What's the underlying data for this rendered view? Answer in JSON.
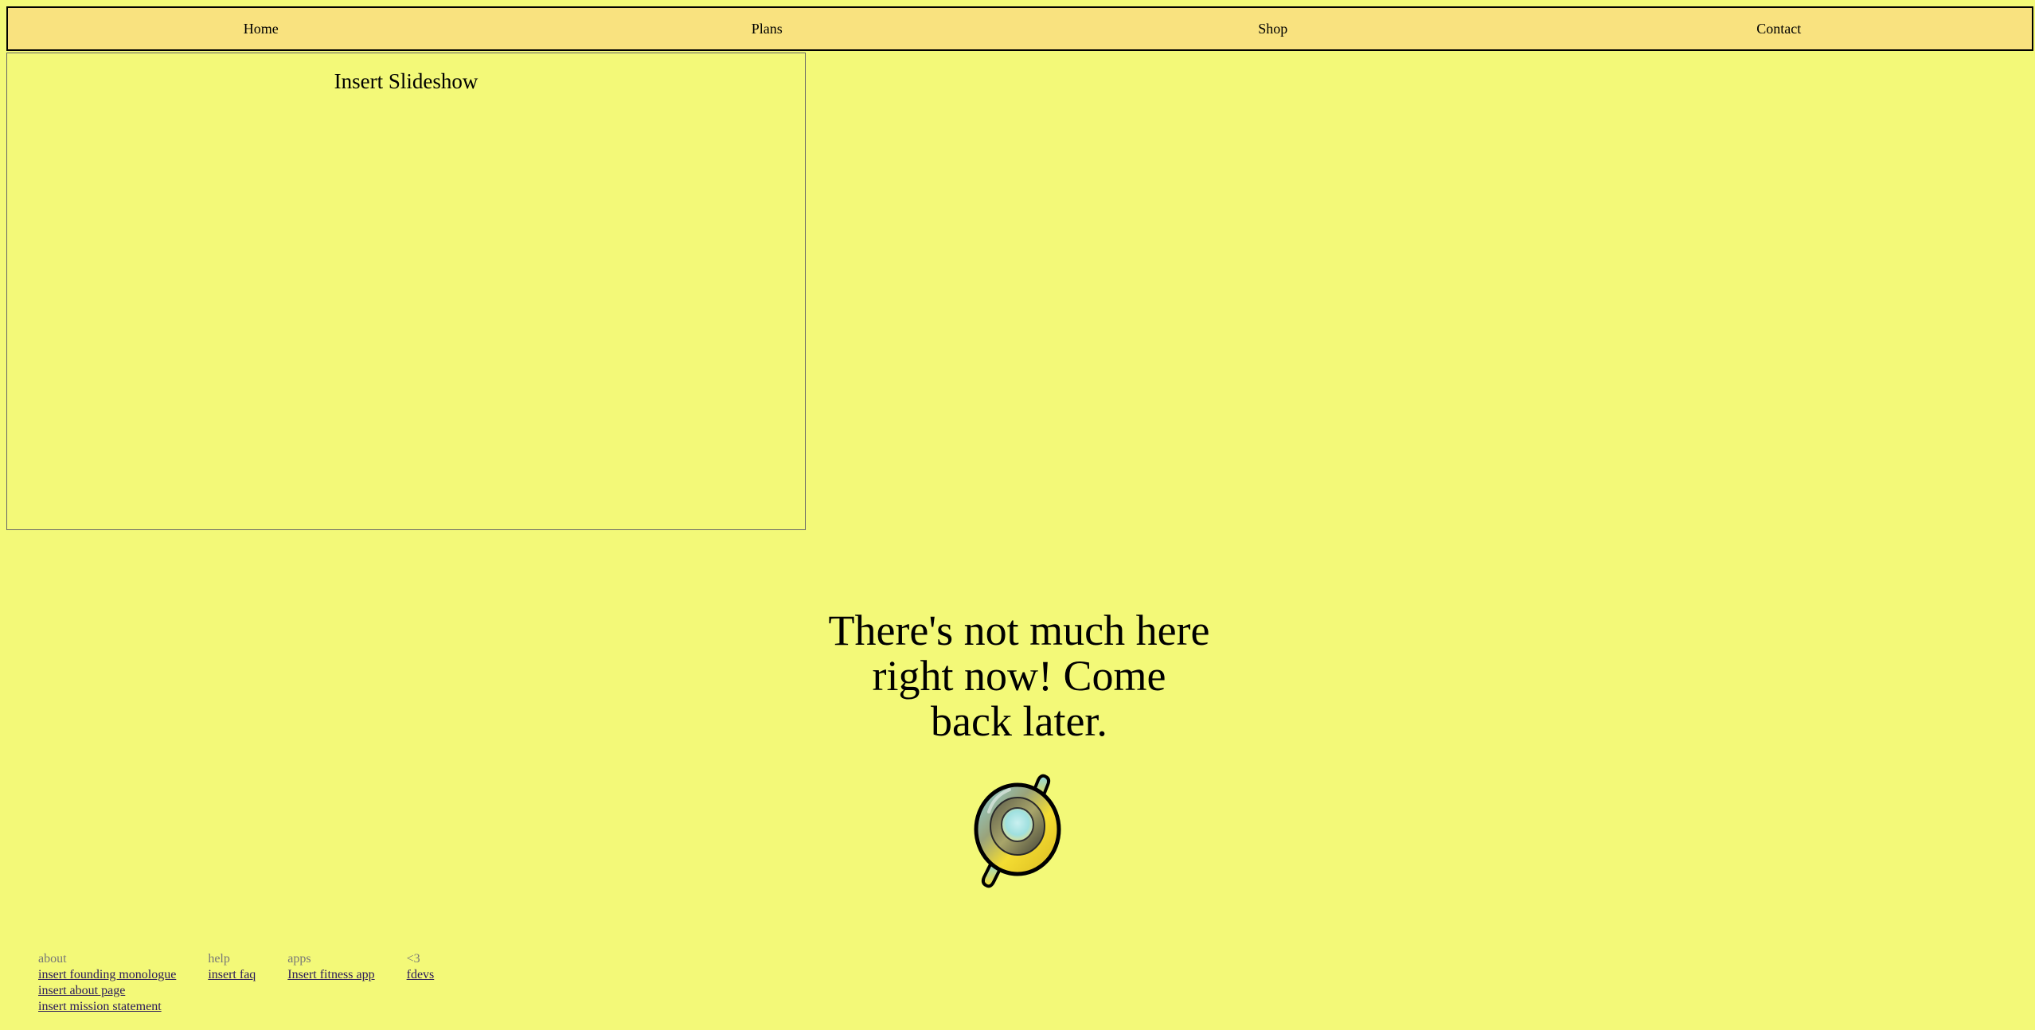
{
  "nav": {
    "items": [
      {
        "label": "Home"
      },
      {
        "label": "Plans"
      },
      {
        "label": "Shop"
      },
      {
        "label": "Contact"
      }
    ]
  },
  "slideshow": {
    "label": "Insert Slideshow"
  },
  "message": {
    "text": "There's not much here right now! Come back later."
  },
  "logo": {
    "icon": "circular-logo-icon"
  },
  "footer": {
    "columns": [
      {
        "heading": "about",
        "links": [
          "insert founding monologue",
          "insert about page",
          "insert mission statement"
        ]
      },
      {
        "heading": "help",
        "links": [
          "insert faq"
        ]
      },
      {
        "heading": "apps",
        "links": [
          "Insert fitness app"
        ]
      },
      {
        "heading": "<3",
        "links": [
          "fdevs"
        ]
      }
    ]
  },
  "colors": {
    "background": "#f3f978",
    "nav_background": "#f9e27f",
    "link": "#2b1a5a",
    "footer_heading": "#777777"
  }
}
